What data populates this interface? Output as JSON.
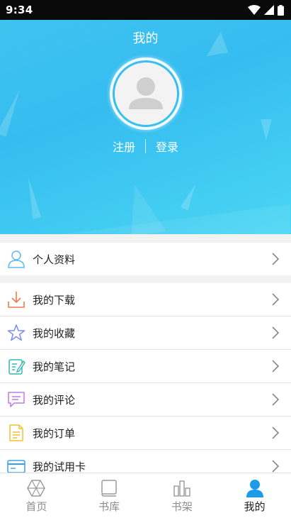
{
  "status_bar": {
    "time": "9:34"
  },
  "header": {
    "title": "我的",
    "register_label": "注册",
    "login_label": "登录"
  },
  "menu": {
    "profile": "个人资料",
    "downloads": "我的下载",
    "favorites": "我的收藏",
    "notes": "我的笔记",
    "comments": "我的评论",
    "orders": "我的订单",
    "trial_cards": "我的试用卡"
  },
  "bottom_nav": {
    "home": "首页",
    "library": "书库",
    "shelf": "书架",
    "mine": "我的"
  },
  "colors": {
    "accent": "#1e9be8",
    "header_bg": "#3fc3ef",
    "inactive": "#8d8d8d"
  }
}
